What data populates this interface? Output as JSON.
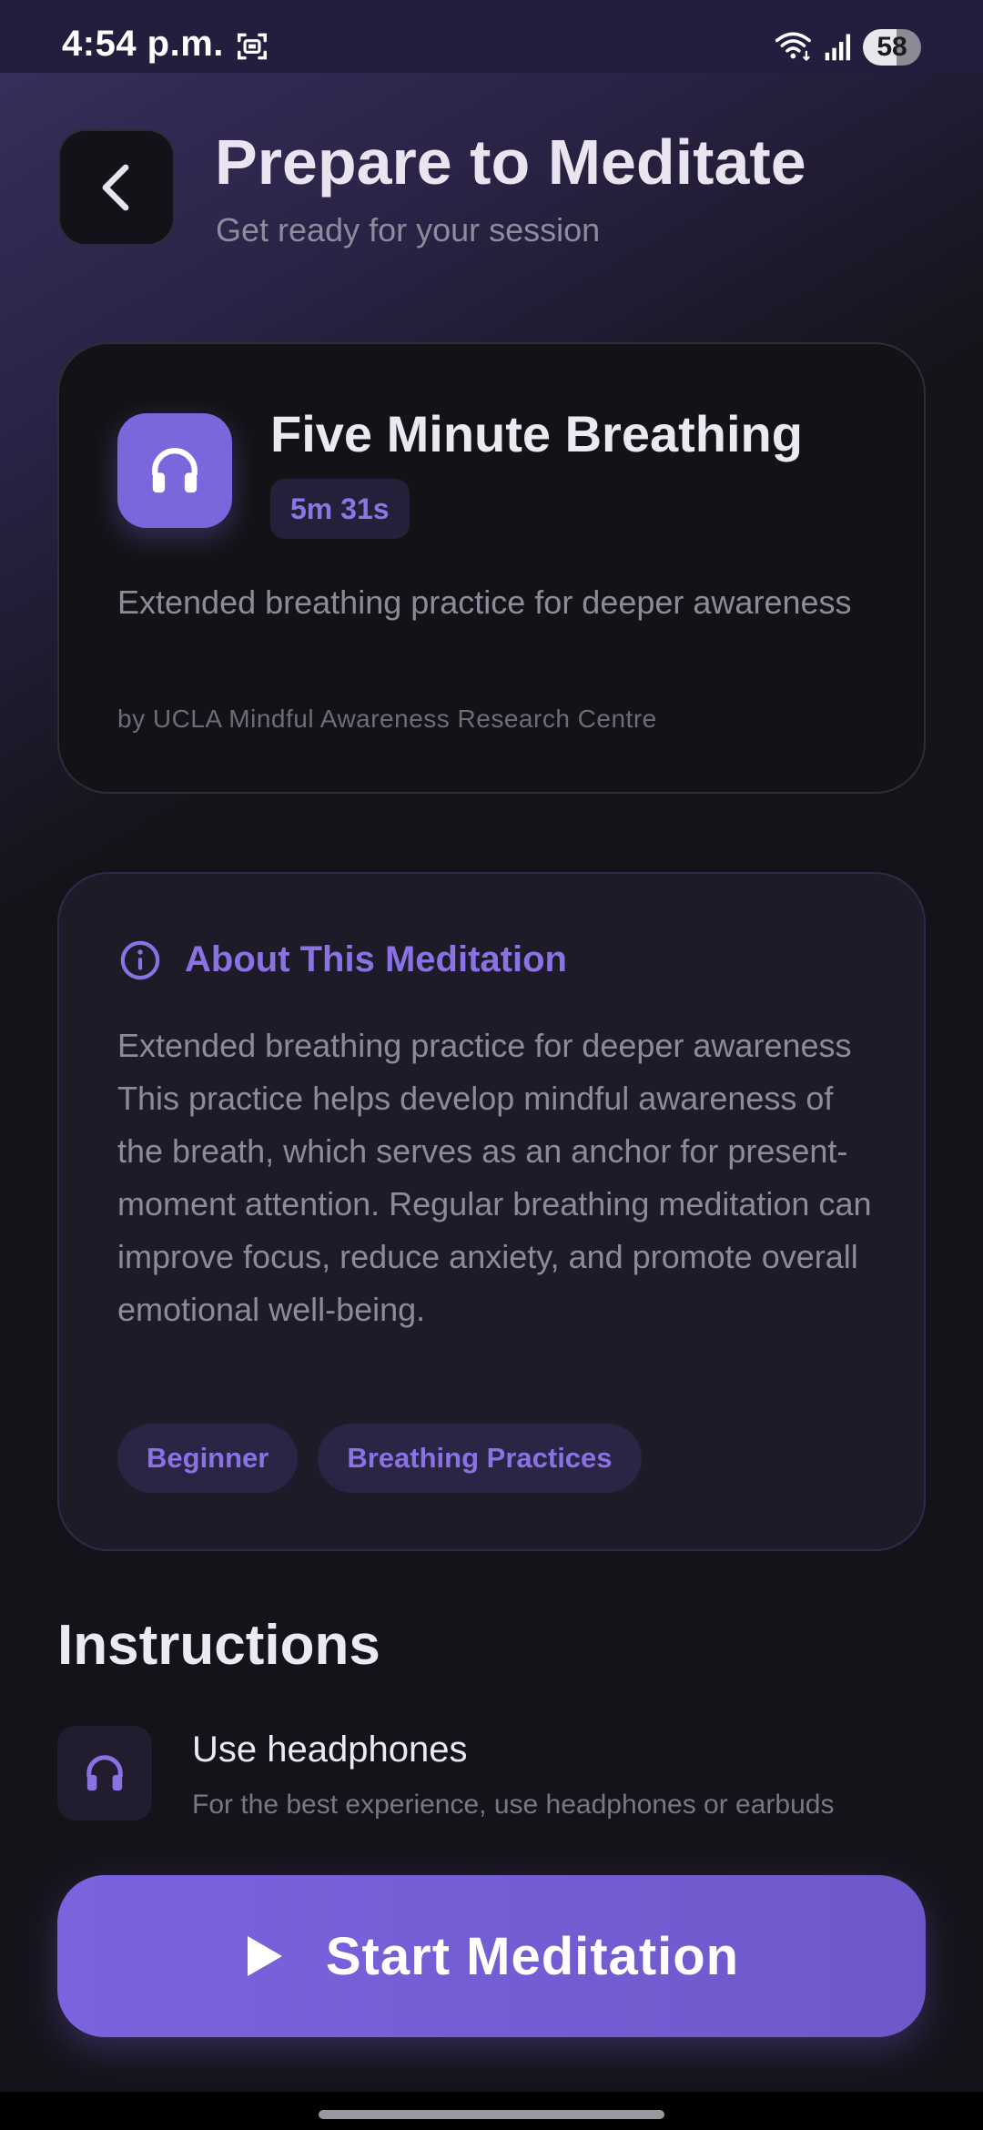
{
  "status_bar": {
    "time": "4:54 p.m.",
    "battery": "58"
  },
  "header": {
    "title": "Prepare to Meditate",
    "subtitle": "Get ready for your session"
  },
  "session": {
    "title": "Five Minute Breathing",
    "duration": "5m 31s",
    "description": "Extended breathing practice for deeper awareness",
    "author": "by UCLA Mindful Awareness Research Centre"
  },
  "about": {
    "title": "About This Meditation",
    "text": "Extended breathing practice for deeper awareness This practice helps develop mindful awareness of the breath, which serves as an anchor for present-moment attention. Regular breathing meditation can improve focus, reduce anxiety, and promote overall emotional well-being.",
    "tags": [
      "Beginner",
      "Breathing Practices"
    ]
  },
  "instructions": {
    "heading": "Instructions",
    "items": [
      {
        "title": "Use headphones",
        "description": "For the best experience, use headphones or earbuds"
      }
    ]
  },
  "start_button": {
    "label": "Start Meditation"
  },
  "colors": {
    "accent": "#7b66dc",
    "accent_text": "#8a72e4",
    "background": "#15131a",
    "card": "#141217"
  },
  "icons": {
    "back": "chevron-left-icon",
    "session": "headphones-icon",
    "about": "info-icon",
    "instruction": "headphones-icon",
    "start": "play-icon"
  }
}
